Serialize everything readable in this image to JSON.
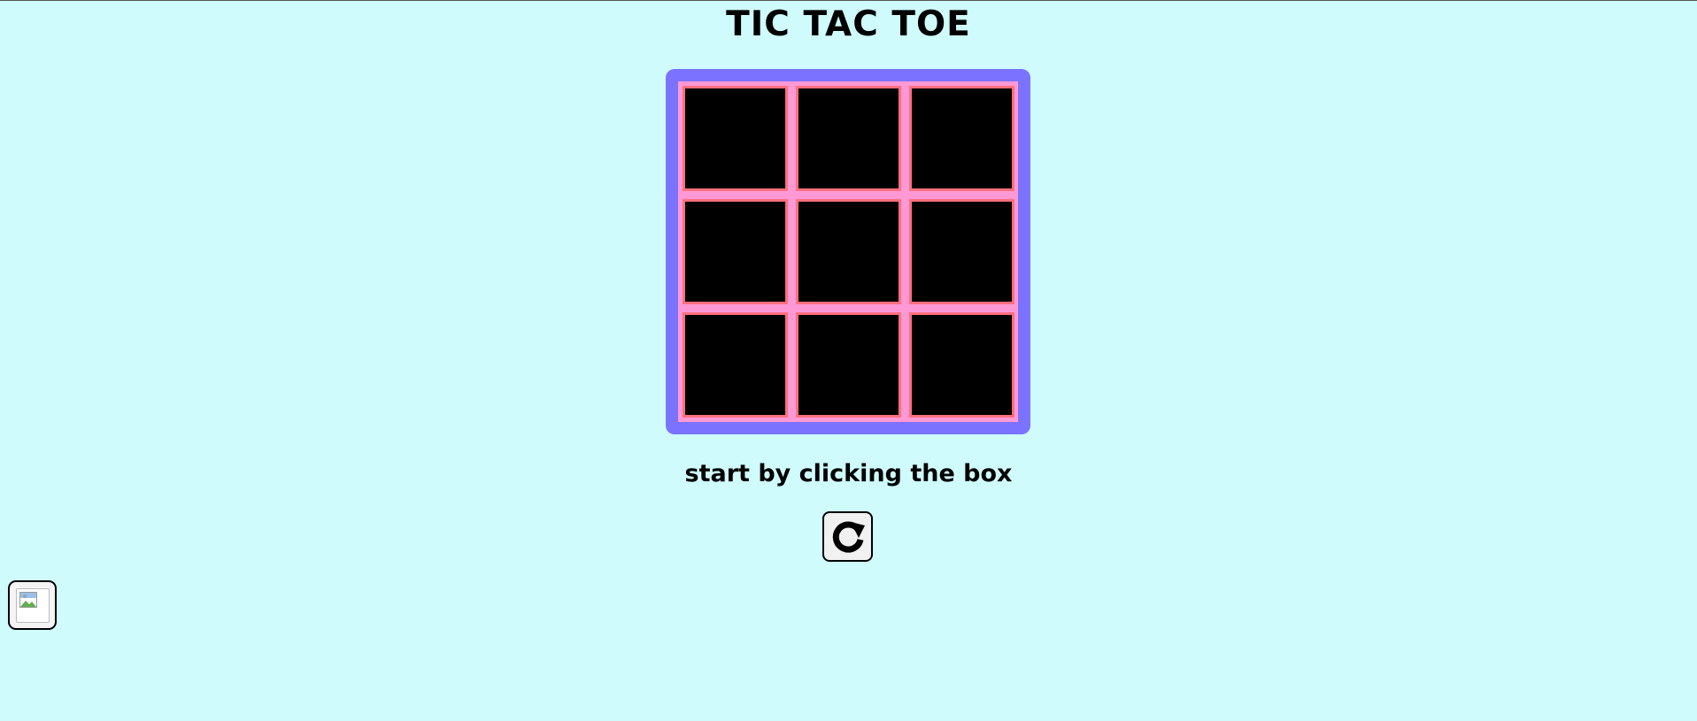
{
  "game": {
    "title": "TIC TAC TOE",
    "status": "start by clicking the box",
    "board": [
      [
        "",
        "",
        ""
      ],
      [
        "",
        "",
        ""
      ],
      [
        "",
        "",
        ""
      ]
    ]
  },
  "controls": {
    "reset_icon": "refresh-icon",
    "image_button_icon": "broken-image-icon"
  },
  "colors": {
    "background": "#cffbfd",
    "frame": "#7b73ff",
    "board_bg": "#ff99d6",
    "cell": "#000000",
    "cell_border": "#ff6f7d"
  }
}
